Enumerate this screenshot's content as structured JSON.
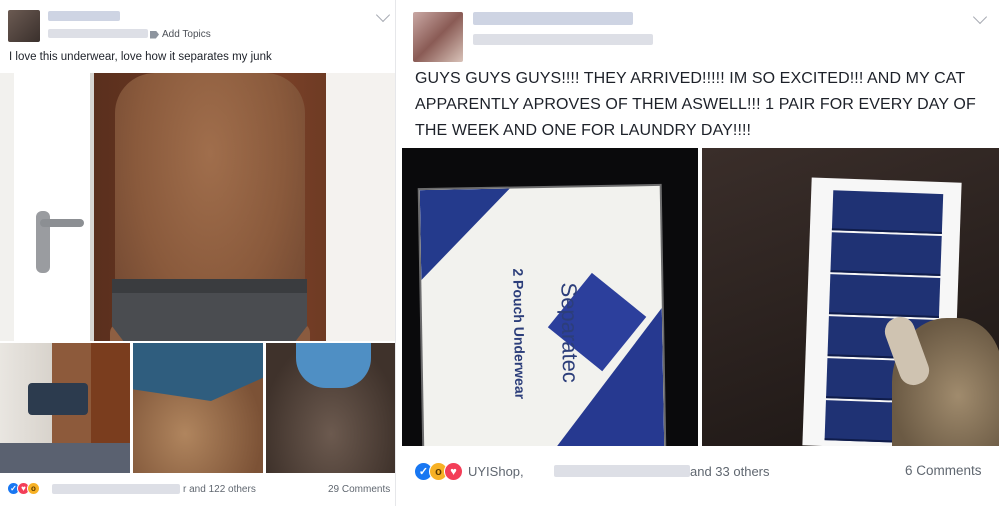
{
  "left_post": {
    "add_topics_label": "Add Topics",
    "caption": "I love this underwear, love how it separates my junk",
    "reactions_tail": "r and 122 others",
    "comments": "29 Comments"
  },
  "right_post": {
    "caption": "GUYS GUYS GUYS!!!! THEY ARRIVED!!!!! IM SO EXCITED!!! AND MY CAT APPARENTLY APROVES OF THEM ASWELL!!! 1 PAIR FOR EVERY DAY OF THE WEEK AND ONE FOR LAUNDRY DAY!!!!",
    "box_brand": "Separatec",
    "box_product": "2 Pouch Underwear",
    "reactions_name": "UYIShop,",
    "reactions_tail": "and 33 others",
    "comments": "6 Comments"
  },
  "icons": {
    "like": "like-icon",
    "love": "love-icon",
    "wow": "wow-icon",
    "chevron": "chevron-down-icon",
    "tag": "tag-icon"
  },
  "colors": {
    "like": "#1877f2",
    "love": "#f33e58",
    "wow": "#f7b125",
    "meta_text": "#606770"
  }
}
